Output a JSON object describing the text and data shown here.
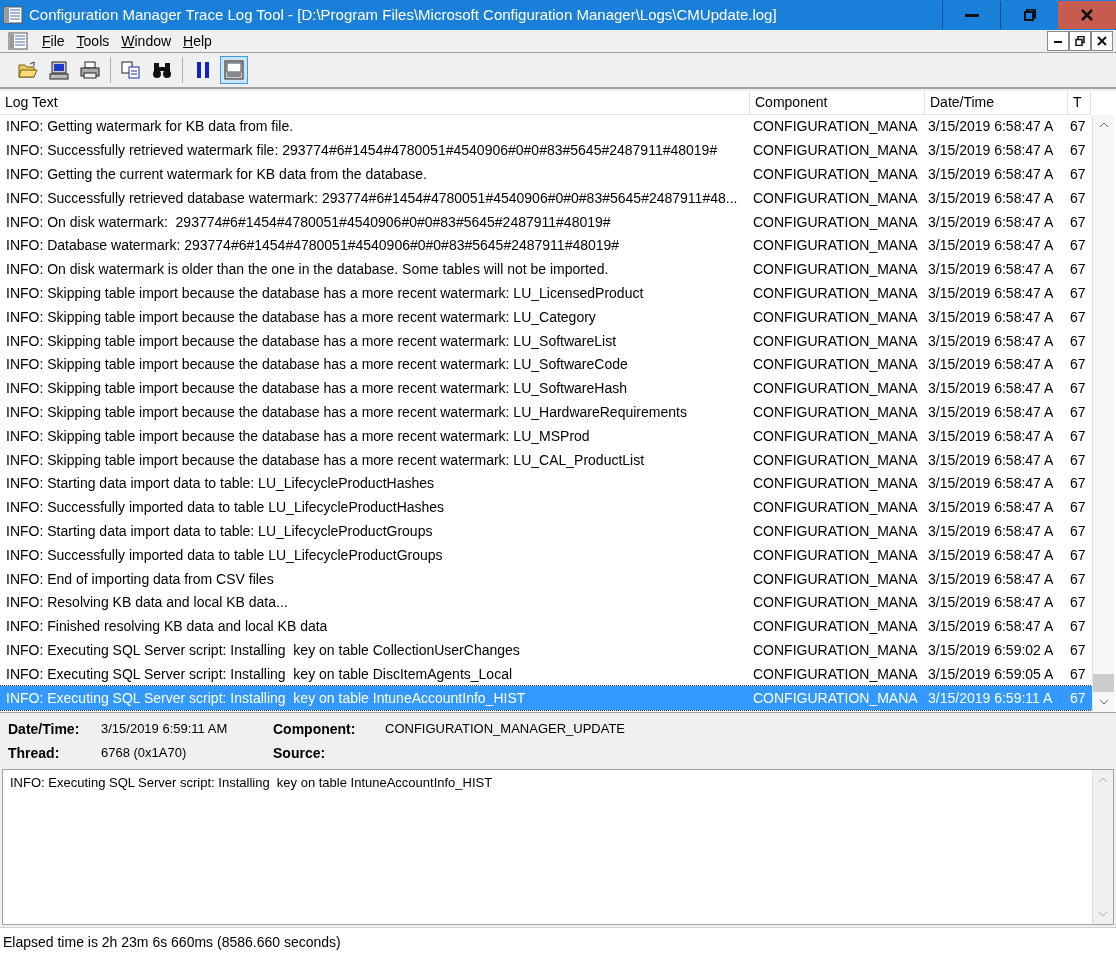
{
  "window": {
    "title": "Configuration Manager Trace Log Tool - [D:\\Program Files\\Microsoft Configuration Manager\\Logs\\CMUpdate.log]"
  },
  "menu": [
    {
      "label": "File"
    },
    {
      "label": "Tools"
    },
    {
      "label": "Window"
    },
    {
      "label": "Help"
    }
  ],
  "toolbar": [
    {
      "kind": "open",
      "pressed": false
    },
    {
      "kind": "computer",
      "pressed": false
    },
    {
      "kind": "print",
      "pressed": false
    },
    {
      "kind": "sep"
    },
    {
      "kind": "copy",
      "pressed": false
    },
    {
      "kind": "find",
      "pressed": false
    },
    {
      "kind": "sep"
    },
    {
      "kind": "pause",
      "pressed": false
    },
    {
      "kind": "details",
      "pressed": true
    }
  ],
  "table": {
    "columns": [
      "Log Text",
      "Component",
      "Date/Time",
      "T"
    ],
    "rows": [
      {
        "log": "INFO: Getting watermark for KB data from file.",
        "component": "CONFIGURATION_MANA",
        "time": "3/15/2019 6:58:47 A",
        "thread": "67",
        "selected": false
      },
      {
        "log": "INFO: Successfully retrieved watermark file: 293774#6#1454#4780051#4540906#0#0#83#5645#2487911#48019#",
        "component": "CONFIGURATION_MANA",
        "time": "3/15/2019 6:58:47 A",
        "thread": "67",
        "selected": false
      },
      {
        "log": "INFO: Getting the current watermark for KB data from the database.",
        "component": "CONFIGURATION_MANA",
        "time": "3/15/2019 6:58:47 A",
        "thread": "67",
        "selected": false
      },
      {
        "log": "INFO: Successfully retrieved database watermark: 293774#6#1454#4780051#4540906#0#0#83#5645#2487911#48...",
        "component": "CONFIGURATION_MANA",
        "time": "3/15/2019 6:58:47 A",
        "thread": "67",
        "selected": false
      },
      {
        "log": "INFO: On disk watermark:  293774#6#1454#4780051#4540906#0#0#83#5645#2487911#48019#",
        "component": "CONFIGURATION_MANA",
        "time": "3/15/2019 6:58:47 A",
        "thread": "67",
        "selected": false
      },
      {
        "log": "INFO: Database watermark: 293774#6#1454#4780051#4540906#0#0#83#5645#2487911#48019#",
        "component": "CONFIGURATION_MANA",
        "time": "3/15/2019 6:58:47 A",
        "thread": "67",
        "selected": false
      },
      {
        "log": "INFO: On disk watermark is older than the one in the database. Some tables will not be imported.",
        "component": "CONFIGURATION_MANA",
        "time": "3/15/2019 6:58:47 A",
        "thread": "67",
        "selected": false
      },
      {
        "log": "INFO: Skipping table import because the database has a more recent watermark: LU_LicensedProduct",
        "component": "CONFIGURATION_MANA",
        "time": "3/15/2019 6:58:47 A",
        "thread": "67",
        "selected": false
      },
      {
        "log": "INFO: Skipping table import because the database has a more recent watermark: LU_Category",
        "component": "CONFIGURATION_MANA",
        "time": "3/15/2019 6:58:47 A",
        "thread": "67",
        "selected": false
      },
      {
        "log": "INFO: Skipping table import because the database has a more recent watermark: LU_SoftwareList",
        "component": "CONFIGURATION_MANA",
        "time": "3/15/2019 6:58:47 A",
        "thread": "67",
        "selected": false
      },
      {
        "log": "INFO: Skipping table import because the database has a more recent watermark: LU_SoftwareCode",
        "component": "CONFIGURATION_MANA",
        "time": "3/15/2019 6:58:47 A",
        "thread": "67",
        "selected": false
      },
      {
        "log": "INFO: Skipping table import because the database has a more recent watermark: LU_SoftwareHash",
        "component": "CONFIGURATION_MANA",
        "time": "3/15/2019 6:58:47 A",
        "thread": "67",
        "selected": false
      },
      {
        "log": "INFO: Skipping table import because the database has a more recent watermark: LU_HardwareRequirements",
        "component": "CONFIGURATION_MANA",
        "time": "3/15/2019 6:58:47 A",
        "thread": "67",
        "selected": false
      },
      {
        "log": "INFO: Skipping table import because the database has a more recent watermark: LU_MSProd",
        "component": "CONFIGURATION_MANA",
        "time": "3/15/2019 6:58:47 A",
        "thread": "67",
        "selected": false
      },
      {
        "log": "INFO: Skipping table import because the database has a more recent watermark: LU_CAL_ProductList",
        "component": "CONFIGURATION_MANA",
        "time": "3/15/2019 6:58:47 A",
        "thread": "67",
        "selected": false
      },
      {
        "log": "INFO: Starting data import data to table: LU_LifecycleProductHashes",
        "component": "CONFIGURATION_MANA",
        "time": "3/15/2019 6:58:47 A",
        "thread": "67",
        "selected": false
      },
      {
        "log": "INFO: Successfully imported data to table LU_LifecycleProductHashes",
        "component": "CONFIGURATION_MANA",
        "time": "3/15/2019 6:58:47 A",
        "thread": "67",
        "selected": false
      },
      {
        "log": "INFO: Starting data import data to table: LU_LifecycleProductGroups",
        "component": "CONFIGURATION_MANA",
        "time": "3/15/2019 6:58:47 A",
        "thread": "67",
        "selected": false
      },
      {
        "log": "INFO: Successfully imported data to table LU_LifecycleProductGroups",
        "component": "CONFIGURATION_MANA",
        "time": "3/15/2019 6:58:47 A",
        "thread": "67",
        "selected": false
      },
      {
        "log": "INFO: End of importing data from CSV files",
        "component": "CONFIGURATION_MANA",
        "time": "3/15/2019 6:58:47 A",
        "thread": "67",
        "selected": false
      },
      {
        "log": "INFO: Resolving KB data and local KB data...",
        "component": "CONFIGURATION_MANA",
        "time": "3/15/2019 6:58:47 A",
        "thread": "67",
        "selected": false
      },
      {
        "log": "INFO: Finished resolving KB data and local KB data",
        "component": "CONFIGURATION_MANA",
        "time": "3/15/2019 6:58:47 A",
        "thread": "67",
        "selected": false
      },
      {
        "log": "INFO: Executing SQL Server script: Installing  key on table CollectionUserChanges",
        "component": "CONFIGURATION_MANA",
        "time": "3/15/2019 6:59:02 A",
        "thread": "67",
        "selected": false
      },
      {
        "log": "INFO: Executing SQL Server script: Installing  key on table DiscItemAgents_Local",
        "component": "CONFIGURATION_MANA",
        "time": "3/15/2019 6:59:05 A",
        "thread": "67",
        "selected": false
      },
      {
        "log": "INFO: Executing SQL Server script: Installing  key on table IntuneAccountInfo_HIST",
        "component": "CONFIGURATION_MANA",
        "time": "3/15/2019 6:59:11 A",
        "thread": "67",
        "selected": true
      }
    ]
  },
  "details": {
    "fields": [
      {
        "label": "Date/Time:",
        "value": "3/15/2019 6:59:11 AM"
      },
      {
        "label": "Component:",
        "value": "CONFIGURATION_MANAGER_UPDATE"
      },
      {
        "label": "Thread:",
        "value": "6768 (0x1A70)"
      },
      {
        "label": "Source:"
      }
    ],
    "message": "INFO: Executing SQL Server script: Installing  key on table IntuneAccountInfo_HIST"
  },
  "status_bar": "Elapsed time is 2h 23m 6s 660ms (8586.660 seconds)"
}
